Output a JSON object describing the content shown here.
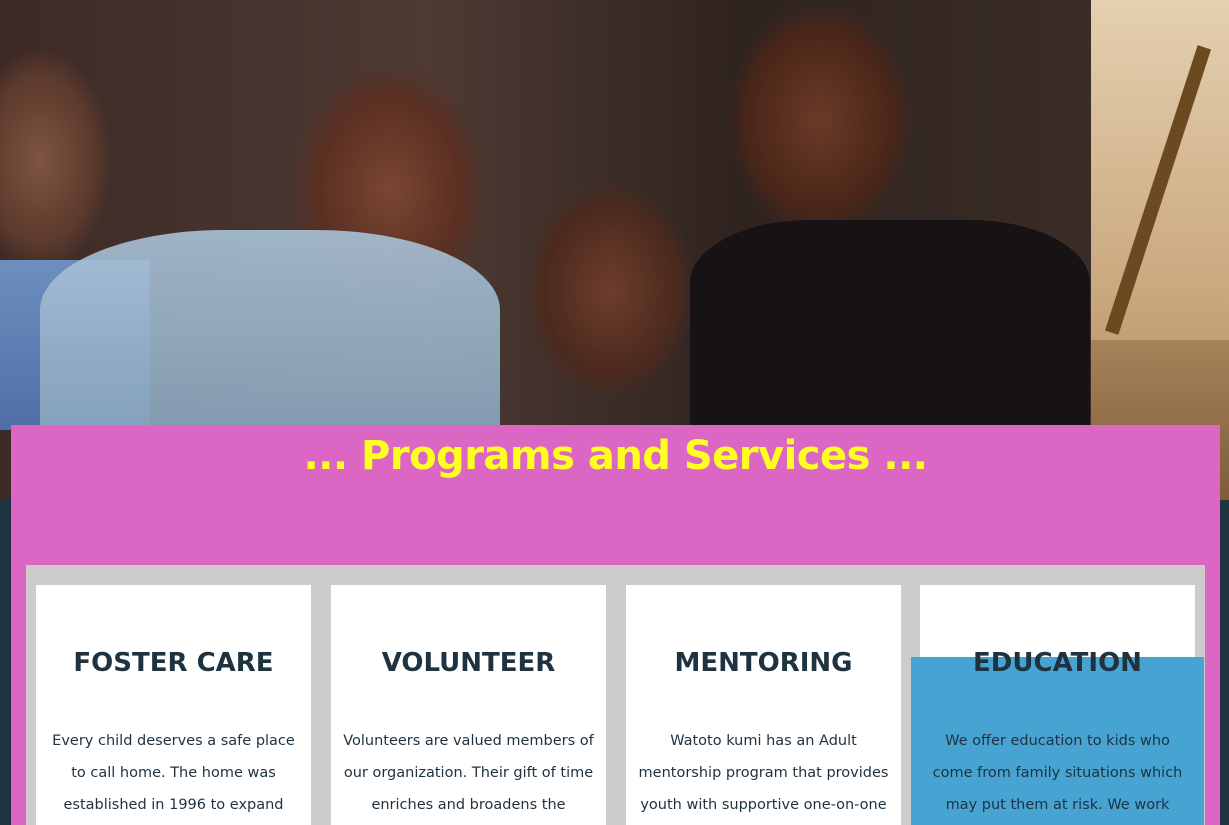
{
  "section": {
    "title": "... Programs and Services ..."
  },
  "cards": [
    {
      "title": "FOSTER CARE",
      "text": "Every child deserves a safe place to call home. The home was established in 1996 to expand residential"
    },
    {
      "title": "VOLUNTEER",
      "text": "Volunteers are valued members of our organization. Their gift of time enriches and broadens the services at"
    },
    {
      "title": "MENTORING",
      "text": "Watoto kumi has an Adult mentorship program that provides youth with supportive one-on-one relationships."
    },
    {
      "title": "EDUCATION",
      "text": "We offer education to kids who come from family situations which may put them at risk. We work creatively to"
    }
  ],
  "colors": {
    "panel": "#dc66c3",
    "title": "#ffff1f",
    "cards_area": "#cccccc",
    "card_text": "#1e3240",
    "highlight": "#47a3d2"
  },
  "hero_image": "children-group-photo"
}
